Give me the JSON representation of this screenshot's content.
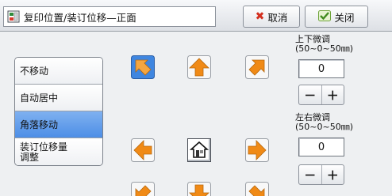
{
  "header": {
    "title": "复印位置/装订位移—正面",
    "cancel_label": "取消",
    "close_label": "关闭"
  },
  "options": [
    {
      "label": "不移动",
      "selected": false
    },
    {
      "label": "自动居中",
      "selected": false
    },
    {
      "label": "角落移动",
      "selected": true
    },
    {
      "label": "装订位移量\n调整",
      "selected": false
    }
  ],
  "vertical": {
    "label_line1": "上下微调",
    "label_line2": "(50~0~50㎜)",
    "value": "0",
    "minus": "－",
    "plus": "＋"
  },
  "horizontal": {
    "label_line1": "左右微调",
    "label_line2": "(50~0~50㎜)",
    "value": "0",
    "minus": "－",
    "plus": "＋"
  },
  "icons": {
    "cancel": "close-x-icon",
    "close": "checkmark-icon",
    "home": "house-icon"
  },
  "colors": {
    "selected_bg": "#5b96e8",
    "blue_tile": "#3f86e0",
    "orange_tile": "#f08a16"
  }
}
